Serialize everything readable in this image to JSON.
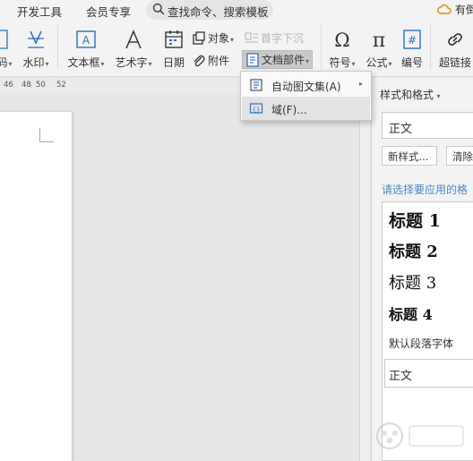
{
  "tabs": {
    "developer_tools": "开发工具",
    "member_features": "会员专享",
    "search": "查找命令、搜索模板",
    "right_item": "有倒"
  },
  "ribbon": {
    "code_partial": "码",
    "watermark": "水印",
    "textbox": "文本框",
    "wordart": "艺术字",
    "date": "日期",
    "object": "对象",
    "attachment": "附件",
    "drop_cap": "首字下沉",
    "doc_parts": "文档部件",
    "symbol": "符号",
    "formula": "公式",
    "numbering": "编号",
    "hyperlink": "超链接"
  },
  "ruler": {
    "ticks": [
      "46",
      "48",
      "50",
      "52"
    ]
  },
  "menu": {
    "items": [
      {
        "label": "自动图文集(A)",
        "has_submenu": true
      },
      {
        "label": "域(F)...",
        "has_submenu": false,
        "highlighted": true
      }
    ]
  },
  "style_pane": {
    "title": "样式和格式",
    "current_style": "正文",
    "new_style_button": "新样式...",
    "clear_button": "清除",
    "apply_prompt": "请选择要应用的格",
    "styles": [
      {
        "label": "标题 1"
      },
      {
        "label": "标题 2"
      },
      {
        "label": "标题 3"
      },
      {
        "label": "标题 4"
      },
      {
        "label": "默认段落字体"
      },
      {
        "label": "正文"
      }
    ]
  },
  "colors": {
    "accent": "#4a86c8",
    "icon_blue": "#2f6ebd",
    "ribbon_bg": "#f3f3f3",
    "active_bg": "#c9c9c9"
  }
}
